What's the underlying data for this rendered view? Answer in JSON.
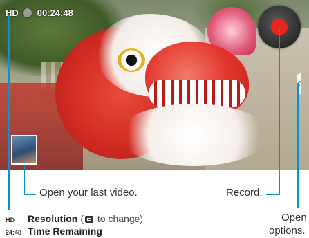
{
  "hud": {
    "resolution": "HD",
    "time_remaining": "00:24:48"
  },
  "callouts": {
    "last_video": "Open your last video.",
    "record": "Record.",
    "options_line1": "Open",
    "options_line2": "options."
  },
  "legend": {
    "resolution_key": "HD",
    "resolution_title": "Resolution",
    "resolution_note_prefix": "(",
    "resolution_note_suffix": " to change)",
    "time_key": "24:48",
    "time_title": "Time Remaining"
  },
  "colors": {
    "callout_line": "#0a8fd8",
    "record_red": "#e8261e"
  },
  "icons": {
    "record": "record-icon",
    "options": "options-tab-icon",
    "resolution": "resolution-icon"
  }
}
